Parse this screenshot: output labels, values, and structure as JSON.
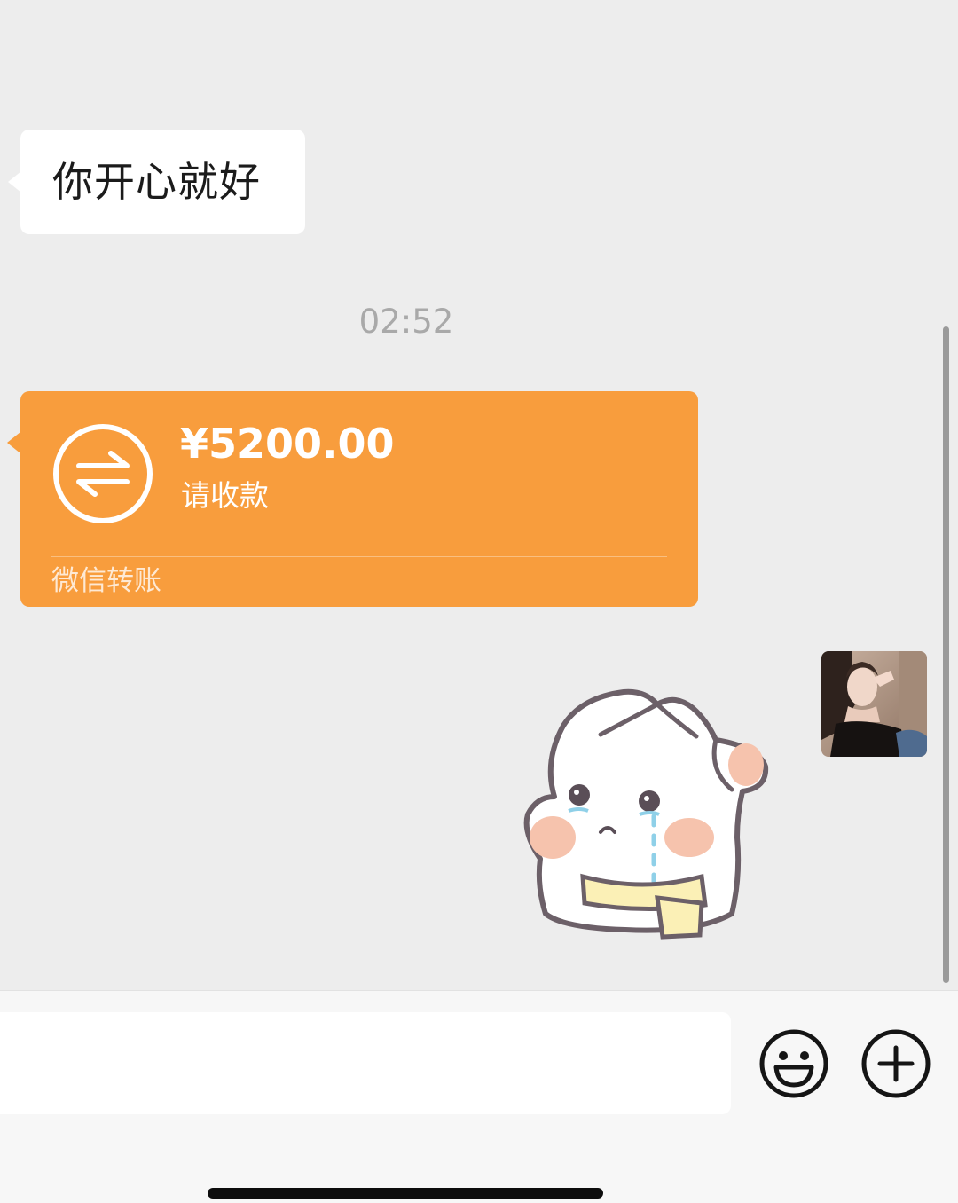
{
  "messages": {
    "text_bubble": "你开心就好",
    "timestamp": "02:52",
    "transfer": {
      "amount": "¥5200.00",
      "status": "请收款",
      "source": "微信转账",
      "icon": "transfer-arrows-icon",
      "color": "#f89d3d"
    },
    "sticker": "crying-bunny-sticker"
  },
  "input_bar": {
    "value": "",
    "placeholder": "",
    "emoji_icon": "emoji-icon",
    "plus_icon": "plus-icon"
  },
  "colors": {
    "chat_background": "#ededed",
    "bubble": "#ffffff",
    "transfer": "#f89d3d",
    "timestamp": "#a9a9a9"
  }
}
